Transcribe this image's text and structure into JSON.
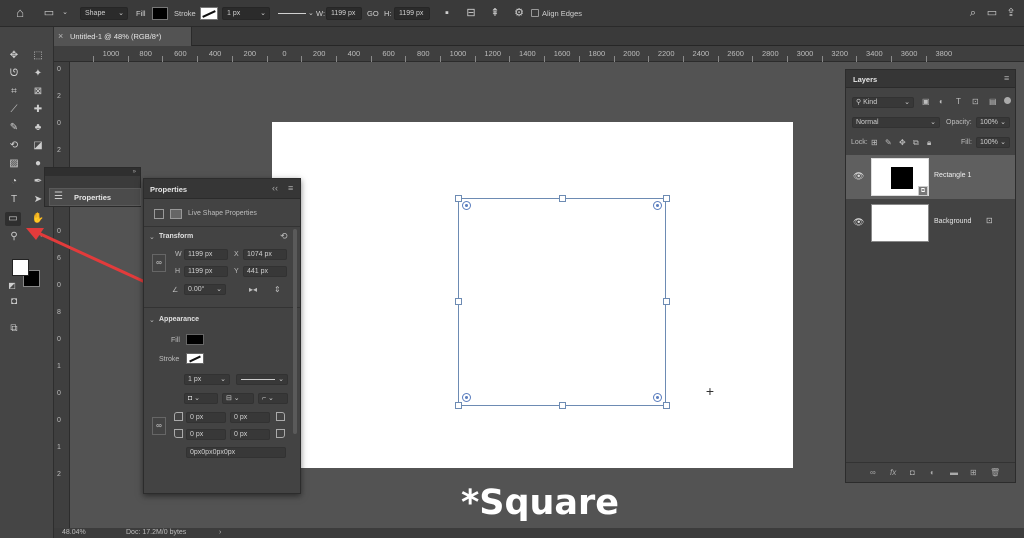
{
  "options_bar": {
    "mode": "Shape",
    "fill_label": "Fill",
    "stroke_label": "Stroke",
    "stroke_width": "1 px",
    "w_label": "W:",
    "w_value": "1199 px",
    "link_label": "GO",
    "h_label": "H:",
    "h_value": "1199 px",
    "align_edges": "Align Edges"
  },
  "document_tab": {
    "title": "Untitled-1 @ 48% (RGB/8*)"
  },
  "ruler": {
    "h_ticks": [
      "1000",
      "800",
      "600",
      "400",
      "200",
      "0",
      "200",
      "400",
      "600",
      "800",
      "1000",
      "1200",
      "1400",
      "1600",
      "1800",
      "2000",
      "2200",
      "2400",
      "2600",
      "2800",
      "3000",
      "3200",
      "3400",
      "3600",
      "3800"
    ],
    "v_ticks": [
      "0",
      "2",
      "0",
      "2",
      "0",
      "4",
      "0",
      "6",
      "0",
      "8",
      "0",
      "1",
      "0",
      "0",
      "1",
      "2"
    ]
  },
  "properties_collapsed": {
    "title": "Properties"
  },
  "properties": {
    "title": "Properties",
    "subtitle": "Live Shape Properties",
    "transform": {
      "header": "Transform",
      "w_label": "W",
      "w_value": "1199 px",
      "x_label": "X",
      "x_value": "1074 px",
      "h_label": "H",
      "h_value": "1199 px",
      "y_label": "Y",
      "y_value": "441 px",
      "angle": "0.00°"
    },
    "appearance": {
      "header": "Appearance",
      "fill_label": "Fill",
      "stroke_label": "Stroke",
      "stroke_width": "1 px",
      "corner_tl": "0 px",
      "corner_tr": "0 px",
      "corner_bl": "0 px",
      "corner_br": "0 px",
      "corners_summary": "0px0px0px0px"
    }
  },
  "layers": {
    "title": "Layers",
    "filter_kind": "Kind",
    "blend_mode": "Normal",
    "opacity_label": "Opacity:",
    "opacity_value": "100%",
    "lock_label": "Lock:",
    "fill_label": "Fill:",
    "fill_value": "100%",
    "items": [
      {
        "name": "Rectangle 1",
        "selected": true
      },
      {
        "name": "Background",
        "selected": false
      }
    ]
  },
  "status": {
    "zoom": "48.04%",
    "doc": "Doc: 17.2M/0 bytes"
  },
  "caption": "*Square",
  "colors": {
    "accent_arrow": "#e23b3b",
    "selection": "#6d8bb3",
    "foreground": "#ffffff",
    "background": "#000000"
  }
}
